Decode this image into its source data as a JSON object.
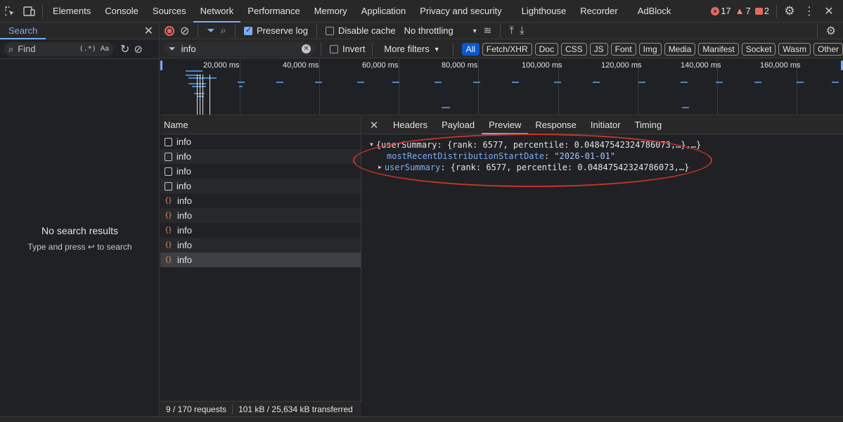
{
  "toptabs": [
    {
      "label": "Elements"
    },
    {
      "label": "Console"
    },
    {
      "label": "Sources"
    },
    {
      "label": "Network",
      "active": true
    },
    {
      "label": "Performance"
    },
    {
      "label": "Memory"
    },
    {
      "label": "Application"
    },
    {
      "label": "Privacy and security"
    },
    {
      "label": "Lighthouse"
    },
    {
      "label": "Recorder"
    },
    {
      "label": "AdBlock"
    }
  ],
  "badges": {
    "errors": "17",
    "warnings": "7",
    "issues": "2"
  },
  "search_panel": {
    "tab_label": "Search",
    "find_placeholder": "Find",
    "regex_label": "(.*)",
    "case_label": "Aa",
    "no_results": "No search results",
    "hint": "Type and press ↩ to search"
  },
  "netbar": {
    "preserve_log": "Preserve log",
    "disable_cache": "Disable cache",
    "throttling": "No throttling"
  },
  "filterbar": {
    "filter_value": "info",
    "invert": "Invert",
    "more_filters": "More filters",
    "chips": [
      "All",
      "Fetch/XHR",
      "Doc",
      "CSS",
      "JS",
      "Font",
      "Img",
      "Media",
      "Manifest",
      "Socket",
      "Wasm",
      "Other"
    ]
  },
  "overview": {
    "ticks": [
      "20,000 ms",
      "40,000 ms",
      "60,000 ms",
      "80,000 ms",
      "100,000 ms",
      "120,000 ms",
      "140,000 ms",
      "160,000 ms"
    ]
  },
  "requests": {
    "header": "Name",
    "rows": [
      {
        "name": "info",
        "type": "doc"
      },
      {
        "name": "info",
        "type": "doc"
      },
      {
        "name": "info",
        "type": "doc"
      },
      {
        "name": "info",
        "type": "doc"
      },
      {
        "name": "info",
        "type": "json"
      },
      {
        "name": "info",
        "type": "json"
      },
      {
        "name": "info",
        "type": "json"
      },
      {
        "name": "info",
        "type": "json"
      },
      {
        "name": "info",
        "type": "json",
        "selected": true
      }
    ],
    "status_count": "9 / 170 requests",
    "status_transfer": "101 kB / 25,634 kB transferred"
  },
  "detail": {
    "tabs": [
      "Headers",
      "Payload",
      "Preview",
      "Response",
      "Initiator",
      "Timing"
    ],
    "active_tab": "Preview",
    "preview": {
      "root_line": "{userSummary: {rank: 6577, percentile: 0.04847542324786073,…},…}",
      "child1_key": "mostRecentDistributionStartDate",
      "child1_value": "\"2026-01-01\"",
      "child2_key": "userSummary",
      "child2_value": "{rank: 6577, percentile: 0.04847542324786073,…}"
    }
  },
  "colors": {
    "accent": "#7cacf8",
    "error": "#e46962",
    "warning": "#f28b54",
    "annotation": "#c7352a"
  }
}
